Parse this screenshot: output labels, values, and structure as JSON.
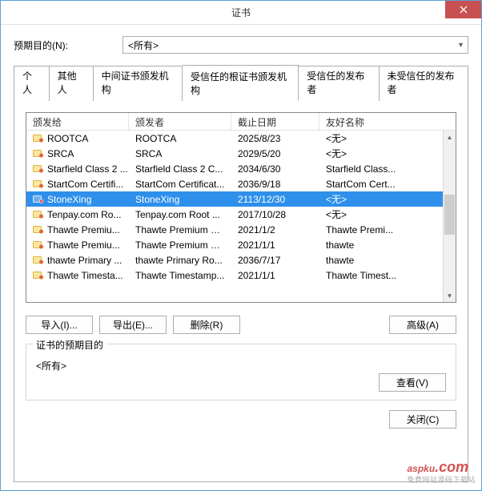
{
  "window": {
    "title": "证书"
  },
  "purpose": {
    "label": "预期目的(N):",
    "value": "<所有>"
  },
  "tabs": [
    {
      "label": "个人"
    },
    {
      "label": "其他人"
    },
    {
      "label": "中间证书颁发机构"
    },
    {
      "label": "受信任的根证书颁发机构"
    },
    {
      "label": "受信任的发布者"
    },
    {
      "label": "未受信任的发布者"
    }
  ],
  "columns": {
    "c1": "颁发给",
    "c2": "颁发者",
    "c3": "截止日期",
    "c4": "友好名称"
  },
  "rows": [
    {
      "c1": "ROOTCA",
      "c2": "ROOTCA",
      "c3": "2025/8/23",
      "c4": "<无>",
      "sel": false
    },
    {
      "c1": "SRCA",
      "c2": "SRCA",
      "c3": "2029/5/20",
      "c4": "<无>",
      "sel": false
    },
    {
      "c1": "Starfield Class 2 ...",
      "c2": "Starfield Class 2 C...",
      "c3": "2034/6/30",
      "c4": "Starfield Class...",
      "sel": false
    },
    {
      "c1": "StartCom Certifi...",
      "c2": "StartCom Certificat...",
      "c3": "2036/9/18",
      "c4": "StartCom Cert...",
      "sel": false
    },
    {
      "c1": "StoneXing",
      "c2": "StoneXing",
      "c3": "2113/12/30",
      "c4": "<无>",
      "sel": true
    },
    {
      "c1": "Tenpay.com Ro...",
      "c2": "Tenpay.com Root ...",
      "c3": "2017/10/28",
      "c4": "<无>",
      "sel": false
    },
    {
      "c1": "Thawte Premiu...",
      "c2": "Thawte Premium S...",
      "c3": "2021/1/2",
      "c4": "Thawte Premi...",
      "sel": false
    },
    {
      "c1": "Thawte Premiu...",
      "c2": "Thawte Premium S...",
      "c3": "2021/1/1",
      "c4": "thawte",
      "sel": false
    },
    {
      "c1": "thawte Primary ...",
      "c2": "thawte Primary Ro...",
      "c3": "2036/7/17",
      "c4": "thawte",
      "sel": false
    },
    {
      "c1": "Thawte Timesta...",
      "c2": "Thawte Timestamp...",
      "c3": "2021/1/1",
      "c4": "Thawte Timest...",
      "sel": false
    }
  ],
  "buttons": {
    "import": "导入(I)...",
    "export": "导出(E)...",
    "delete": "删除(R)",
    "advanced": "高级(A)",
    "view": "查看(V)",
    "close": "关闭(C)"
  },
  "groupbox": {
    "title": "证书的预期目的",
    "text": "<所有>"
  },
  "watermark": {
    "main": "aspku",
    "suffix": ".com",
    "sub": "免费网站源码下载站"
  }
}
